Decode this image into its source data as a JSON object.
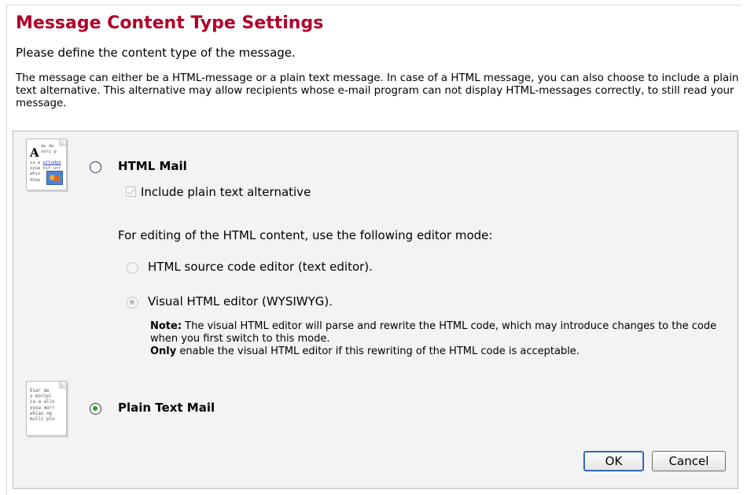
{
  "header": {
    "title": "Message Content Type Settings",
    "subtitle": "Please define the content type of the message.",
    "description": "The message can either be a HTML-message or a plain text message. In case of a HTML message, you can also choose to include a plain text alternative. This alternative may allow recipients whose e-mail program can not display HTML-messages correctly, to still read your message."
  },
  "html_mail": {
    "label": "HTML Mail",
    "selected": false,
    "include_plain_text_label": "Include plain text alternative",
    "include_plain_text_checked": true,
    "editor_mode_prompt": "For editing of the HTML content, use the following editor mode:",
    "editor_options": [
      {
        "label": "HTML source code editor (text editor).",
        "selected": false
      },
      {
        "label": "Visual HTML editor (WYSIWYG).",
        "selected": true
      }
    ],
    "note_label": "Note:",
    "note_text": " The visual HTML editor will parse and rewrite the HTML code, which may introduce changes to the code when you first switch to this mode.",
    "only_label": "Only",
    "only_text": " enable the visual HTML editor if this rewriting of the HTML code is acceptable."
  },
  "plain_text_mail": {
    "label": "Plain Text Mail",
    "selected": true
  },
  "html_icon_text": {
    "big_letter": "A",
    "lines_right": "ão de\nsori p",
    "line3_prefix": "ia a ",
    "line3_link": "allodyo",
    "lines_rest": "xyua nif urr\nwhis\ndiay"
  },
  "plain_icon_text": "Diar de\no moripl\nia a allo\nxyua morr\nwhias og\nmulli plu",
  "buttons": {
    "ok_label": "OK",
    "cancel_label": "Cancel"
  },
  "colors": {
    "title": "#b0002a",
    "panel_background": "#f3f3f3",
    "selected_radio_dot": "#27a327"
  }
}
